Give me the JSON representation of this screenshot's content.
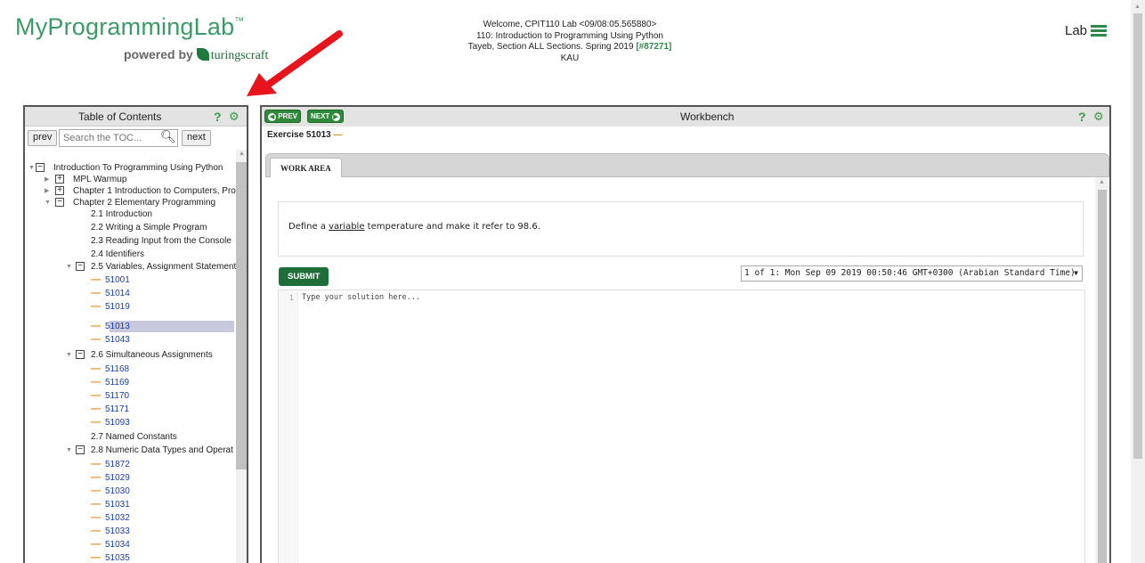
{
  "brand": {
    "title": "MyProgrammingLab",
    "tm": "™",
    "powered_by": "powered by",
    "turingscraft": "turingscraft"
  },
  "welcome": {
    "line1": "Welcome, CPIT110 Lab <09/08:05.565880>",
    "line2": "110: Introduction to Programming Using Python",
    "line3_prefix": "Tayeb, Section ALL Sections. Spring 2019 ",
    "line3_id": "[#87271]",
    "line4": "KAU"
  },
  "header": {
    "lab_label": "Lab"
  },
  "toc": {
    "title": "Table of Contents",
    "help": "?",
    "prev": "prev",
    "next": "next",
    "search_placeholder": "Search the TOC...",
    "items": [
      {
        "label": "Introduction To Programming Using Python"
      },
      {
        "label": "MPL Warmup"
      },
      {
        "label": "Chapter 1 Introduction to Computers, Pro"
      },
      {
        "label": "Chapter 2 Elementary Programming"
      },
      {
        "label": "2.1 Introduction"
      },
      {
        "label": "2.2 Writing a Simple Program"
      },
      {
        "label": "2.3 Reading Input from the Console"
      },
      {
        "label": "2.4 Identifiers"
      },
      {
        "label": "2.5 Variables, Assignment Statement"
      },
      {
        "label": "51001"
      },
      {
        "label": "51014"
      },
      {
        "label": "51019"
      },
      {
        "label": "51013"
      },
      {
        "label": "51043"
      },
      {
        "label": "2.6 Simultaneous Assignments"
      },
      {
        "label": "51168"
      },
      {
        "label": "51169"
      },
      {
        "label": "51170"
      },
      {
        "label": "51171"
      },
      {
        "label": "51093"
      },
      {
        "label": "2.7 Named Constants"
      },
      {
        "label": "2.8 Numeric Data Types and Operat"
      },
      {
        "label": "51872"
      },
      {
        "label": "51029"
      },
      {
        "label": "51030"
      },
      {
        "label": "51031"
      },
      {
        "label": "51032"
      },
      {
        "label": "51033"
      },
      {
        "label": "51034"
      },
      {
        "label": "51035"
      }
    ]
  },
  "workbench": {
    "title": "Workbench",
    "help": "?",
    "prev": "PREV",
    "next": "NEXT",
    "exercise": "Exercise 51013",
    "exercise_dash": "—",
    "tab": "WORK AREA",
    "prompt_prefix": "Define a ",
    "prompt_link": "variable",
    "prompt_suffix": " temperature and make it refer to 98.6.",
    "submit": "SUBMIT",
    "attempt_select": "1 of 1: Mon Sep 09 2019 00:50:46 GMT+0300 (Arabian Standard Time)",
    "line_number": "1",
    "editor_placeholder": "Type your solution here..."
  },
  "colors": {
    "brand_green": "#3b9b66",
    "button_green": "#2e8a3a",
    "submit_green": "#1f6e3a",
    "arrow_red": "#e8141b",
    "orange_dash": "#e08a1a",
    "link_blue": "#1a3ea8"
  }
}
